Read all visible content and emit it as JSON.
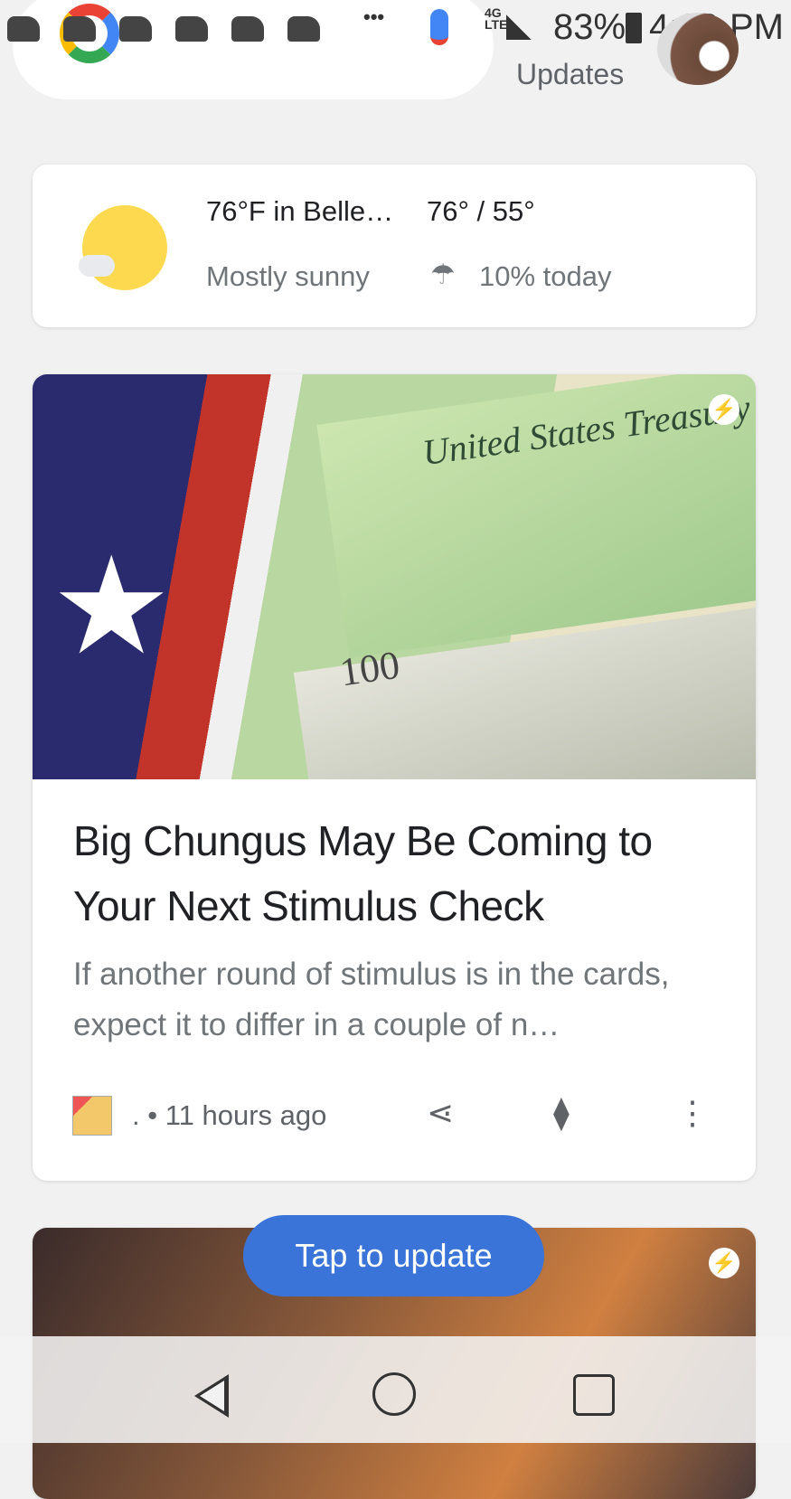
{
  "status_bar": {
    "battery": "83%",
    "time": "4:29 PM",
    "network": "4G LTE"
  },
  "header": {
    "updates_label": "Updates"
  },
  "weather": {
    "temp_location": "76°F in Belle…",
    "high_low": "76° / 55°",
    "condition": "Mostly sunny",
    "precip": "10% today"
  },
  "news": {
    "image_text": {
      "check": "United States Treasury",
      "bill": "100"
    },
    "headline": "Big Chungus May Be Coming to Your Next Stimulus Check",
    "snippet": "If another round of stimulus is in the cards, expect it to differ in a couple of n…",
    "source": ".",
    "time": "• 11 hours ago"
  },
  "update_button": {
    "label": "Tap to update"
  }
}
